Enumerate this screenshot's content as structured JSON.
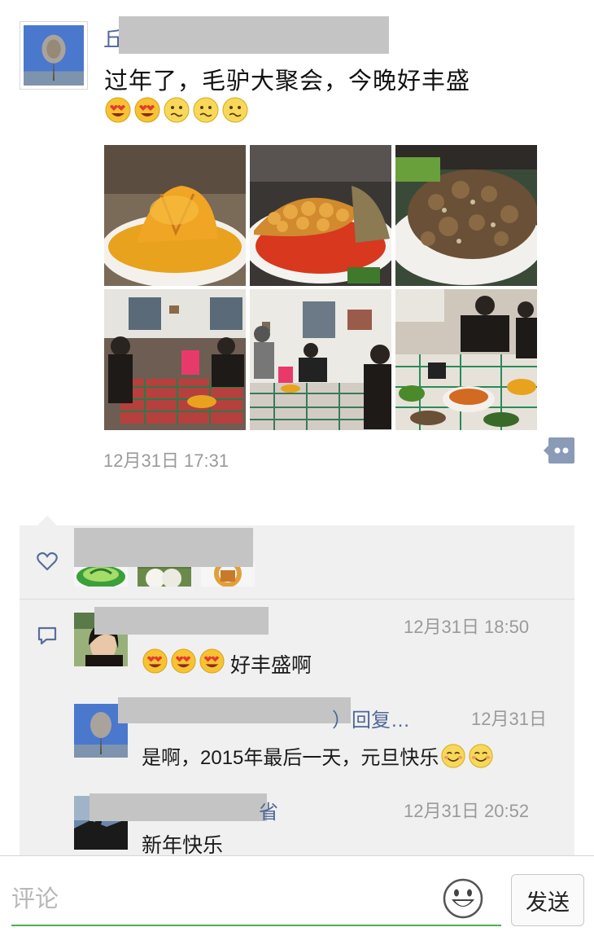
{
  "post": {
    "author_visible_char": "丘",
    "text": "过年了，毛驴大聚会，今晚好丰盛",
    "emojis": [
      "heart-eyes",
      "heart-eyes",
      "confused",
      "confused",
      "confused"
    ],
    "photos": [
      "pumpkin-dish",
      "fried-fish-dish",
      "fried-meat-dish",
      "dining-room-1",
      "dining-room-2",
      "dining-table-closeup"
    ],
    "time": "12月31日 17:31"
  },
  "likes": {
    "avatars": [
      "green-leaf-avatar",
      "white-vase-avatar",
      "orange-ring-avatar"
    ]
  },
  "comments": [
    {
      "time": "12月31日 18:50",
      "emojis": [
        "heart-eyes",
        "heart-eyes",
        "heart-eyes"
      ],
      "text": "好丰盛啊"
    },
    {
      "name_visible_suffix": "）回复…",
      "time": "12月31日",
      "text": "是啊，2015年最后一天，元旦快乐",
      "emojis": [
        "smile",
        "smile"
      ]
    },
    {
      "name_visible_suffix": "省",
      "time": "12月31日 20:52",
      "text": "新年快乐"
    }
  ],
  "input": {
    "placeholder": "评论",
    "send_label": "发送"
  },
  "colors": {
    "name_blue": "#4f6796",
    "panel_bg": "#f0f0f0",
    "accent_green": "#4cb04c"
  }
}
